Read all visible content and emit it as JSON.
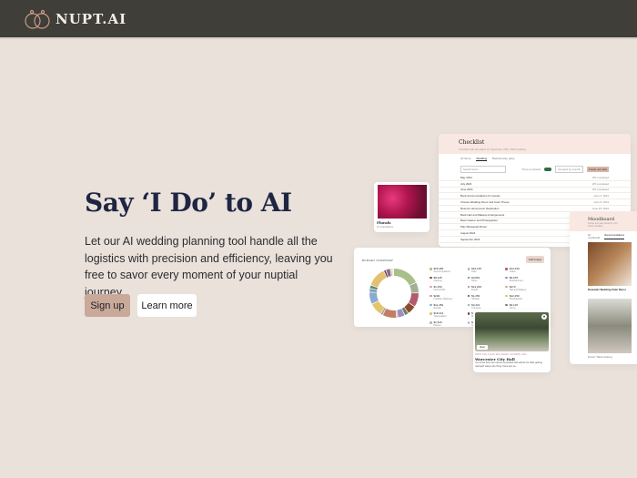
{
  "header": {
    "brand": "NUPT.AI"
  },
  "hero": {
    "title": "Say ‘I Do’ to AI",
    "lead": "Let our AI wedding planning tool handle all the logistics with precision and efficiency, leaving you free to savor every moment of your nuptial journey",
    "signup": "Sign up",
    "learn_more": "Learn more"
  },
  "checklist": {
    "title": "Checklist",
    "subtitle": "Checklist with due dates for September 24th, 2024 wedding",
    "tabs": [
      "All items",
      "Wedding",
      "Bachelorette party"
    ],
    "search_placeholder": "Search items",
    "show_completed": "Show completed",
    "group": "Grouped by months",
    "create": "Create new task",
    "rows": [
      {
        "l": "May 2024",
        "r": "3/5 completed"
      },
      {
        "l": "July 2024",
        "r": "2/5 completed"
      },
      {
        "l": "June 2024",
        "r": "3/5 completed"
      },
      {
        "l": "Book Accommodations for Guests",
        "r": "June 2, 2024"
      },
      {
        "l": "Choose Wedding Decor and Color Theme",
        "r": "June 8, 2024"
      },
      {
        "l": "Reserve Honeymoon Destination",
        "r": "June 15, 2024"
      },
      {
        "l": "Book Hair and Makeup Arrangements",
        "r": "June 20, 2024"
      },
      {
        "l": "Book Caterer and Photographer",
        "r": "June 26, 2024"
      },
      {
        "l": "Plan Rehearsal Dinner",
        "r": ""
      },
      {
        "l": "August 2024",
        "r": ""
      },
      {
        "l": "September 2024",
        "r": ""
      }
    ]
  },
  "budget": {
    "title": "BUDGET OVERVIEW",
    "edit": "Edit budget",
    "items": [
      {
        "a": "$25,482",
        "c": "Accommodations",
        "color": "#a9bf8a"
      },
      {
        "a": "$10,135",
        "c": "Attire",
        "color": "#a3b094"
      },
      {
        "a": "$13,230",
        "c": "Cakes",
        "color": "#b45a6e"
      },
      {
        "a": "$8,245",
        "c": "Catering",
        "color": "#8b4a2e"
      },
      {
        "a": "$3,861",
        "c": "Décor",
        "color": "#6f7f72"
      },
      {
        "a": "$6,678",
        "c": "Entertainment",
        "color": "#9b8fbf"
      },
      {
        "a": "$1,250",
        "c": "Favors/Gifts",
        "color": "#d8a0a8"
      },
      {
        "a": "$13,200",
        "c": "Florals",
        "color": "#c07e62"
      },
      {
        "a": "$470",
        "c": "Hair and Makeup",
        "color": "#d3a88e"
      },
      {
        "a": "$292",
        "c": "Invitation Stationery",
        "color": "#d68ab0"
      },
      {
        "a": "$1,250",
        "c": "Officiant",
        "color": "#2f5a78"
      },
      {
        "a": "$12,250",
        "c": "Photographer",
        "color": "#e3c56a"
      },
      {
        "a": "$11,282",
        "c": "Rentals",
        "color": "#8aaad0"
      },
      {
        "a": "$3,421",
        "c": "Transport",
        "color": "#7fa0b0"
      },
      {
        "a": "$3,125",
        "c": "Venue",
        "color": "#5f8a78"
      },
      {
        "a": "$18,221",
        "c": "Videographer",
        "color": "#e4c170"
      },
      {
        "a": "$2,120",
        "c": "Miscellaneous",
        "color": "#6e3a52"
      },
      {
        "a": "$4,124",
        "c": "Music",
        "color": "#8a6a80"
      },
      {
        "a": "$1,520",
        "c": "Planner",
        "color": "#c7b2a0"
      },
      {
        "a": "$950",
        "c": "Licenses",
        "color": "#a0c0c8"
      },
      {
        "a": "$760",
        "c": "Other",
        "color": "#b0a090"
      }
    ]
  },
  "florals": {
    "title": "Florals",
    "sub": "12 inspirations"
  },
  "venue": {
    "tag": "Ideal",
    "address": "20201 Civic Center Way, Malibu, CA 90265, USA",
    "title": "Worcester City Hall",
    "desc": "You know how the internet is packed with advice for folks getting married? Here's the thing: there are so..."
  },
  "moodboard": {
    "title": "Moodboard",
    "subtitle": "Curate and save ideas for your dream wedding",
    "tabs": [
      "My moodboard",
      "Recommendations"
    ],
    "card1": "Romantic Wedding Chair Décor",
    "card2": "Rustic Table Setting"
  }
}
